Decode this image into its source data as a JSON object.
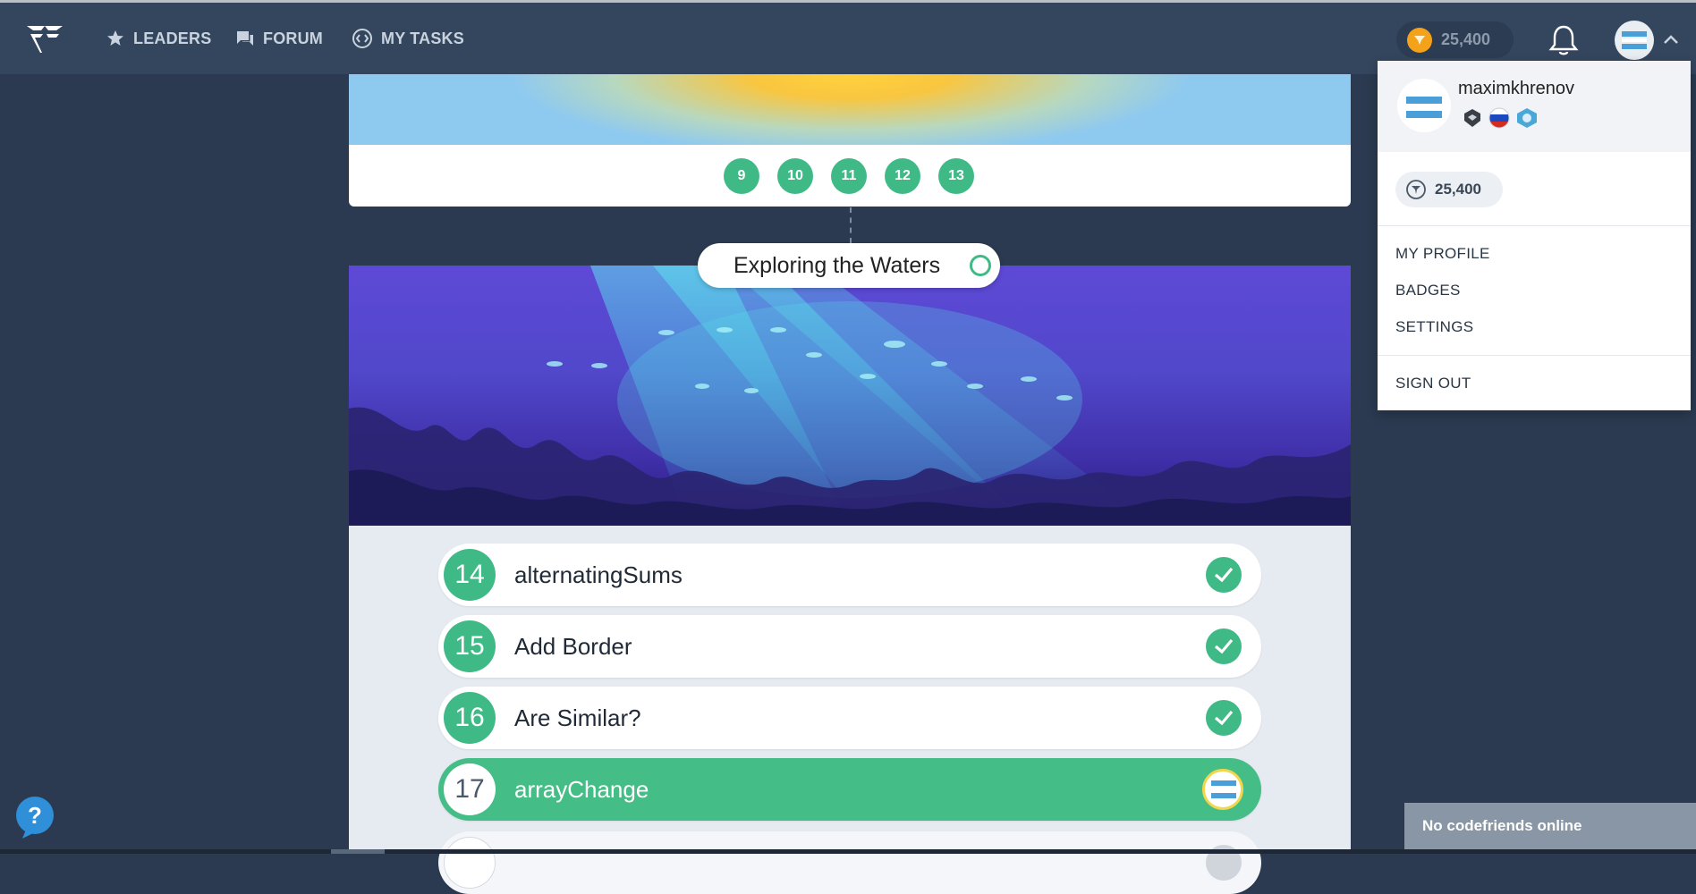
{
  "header": {
    "nav": [
      {
        "label": "LEADERS",
        "icon": "star-icon"
      },
      {
        "label": "FORUM",
        "icon": "chat-icon"
      },
      {
        "label": "MY TASKS",
        "icon": "code-icon"
      }
    ],
    "coins": "25,400"
  },
  "top_levels": [
    "9",
    "10",
    "11",
    "12",
    "13"
  ],
  "chapter": {
    "title": "Exploring the Waters"
  },
  "tasks": [
    {
      "num": "14",
      "name": "alternatingSums",
      "status": "done"
    },
    {
      "num": "15",
      "name": "Add Border",
      "status": "done"
    },
    {
      "num": "16",
      "name": "Are Similar?",
      "status": "done"
    },
    {
      "num": "17",
      "name": "arrayChange",
      "status": "current"
    }
  ],
  "menu": {
    "username": "maximkhrenov",
    "coins": "25,400",
    "items": [
      "MY PROFILE",
      "BADGES",
      "SETTINGS"
    ],
    "signout": "SIGN OUT"
  },
  "footer": {
    "friends_status": "No codefriends online"
  },
  "colors": {
    "accent_green": "#3fba87",
    "header_bg": "#34465e",
    "page_bg": "#2b3a50"
  }
}
